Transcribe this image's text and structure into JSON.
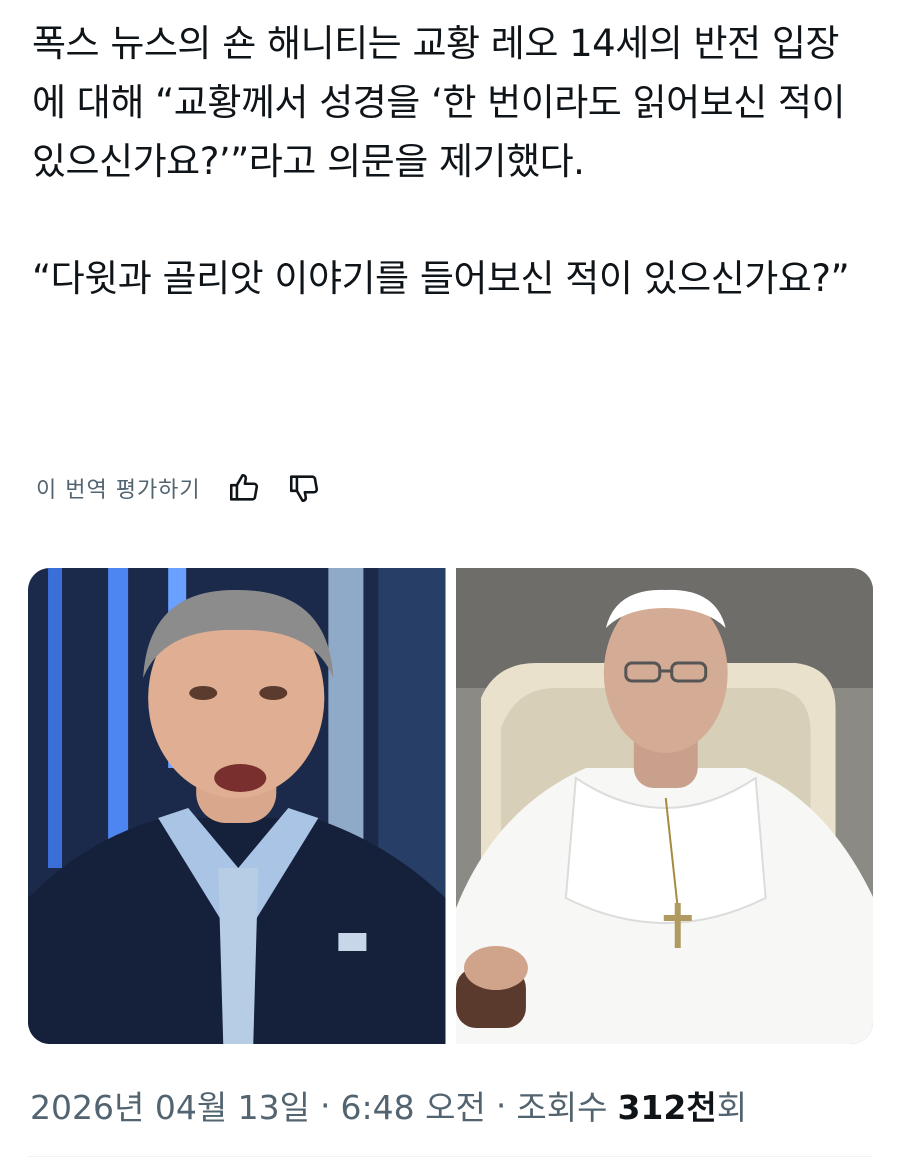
{
  "post": {
    "paragraph1": "폭스 뉴스의 숀 해니티는 교황 레오 14세의 반전 입장에 대해 “교황께서 성경을 ‘한 번이라도 읽어보신 적이 있으신가요?’”라고 의문을 제기했다.",
    "paragraph2": "“다윗과 골리앗 이야기를 들어보신 적이 있으신가요?”"
  },
  "translation": {
    "rate_label": "이 번역 평가하기",
    "thumbs_up_icon": "thumbs-up-icon",
    "thumbs_down_icon": "thumbs-down-icon"
  },
  "media": [
    {
      "name": "photo-sean-hannity"
    },
    {
      "name": "photo-pope-leo"
    }
  ],
  "meta": {
    "date": "2026년 04월 13일",
    "separator": "·",
    "time": "6:48 오전",
    "views_label": "조회수",
    "views_count": "312천",
    "views_suffix": "회"
  },
  "colors": {
    "text": "#0f1419",
    "secondary": "#536471",
    "divider": "#eff3f4"
  }
}
